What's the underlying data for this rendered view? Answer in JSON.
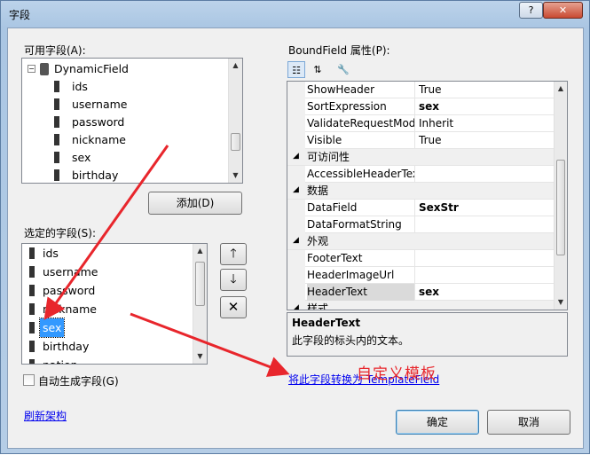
{
  "window": {
    "title": "字段",
    "help_glyph": "?",
    "close_glyph": "✕"
  },
  "available": {
    "label": "可用字段(A):",
    "root": "DynamicField",
    "items": [
      "ids",
      "username",
      "password",
      "nickname",
      "sex",
      "birthday"
    ]
  },
  "add_button": "添加(D)",
  "selected": {
    "label": "选定的字段(S):",
    "items": [
      "ids",
      "username",
      "password",
      "nickname",
      "sex",
      "birthday",
      "nation"
    ],
    "selected_item": "sex"
  },
  "auto_generate_label": "自动生成字段(G)",
  "refresh_link": "刷新架构",
  "properties": {
    "label": "BoundField 属性(P):",
    "rows": [
      {
        "kind": "prop",
        "name": "ShowHeader",
        "value": "True"
      },
      {
        "kind": "prop",
        "name": "SortExpression",
        "value": "sex",
        "bold": true
      },
      {
        "kind": "prop",
        "name": "ValidateRequestMode",
        "value": "Inherit"
      },
      {
        "kind": "prop",
        "name": "Visible",
        "value": "True"
      },
      {
        "kind": "cat",
        "name": "可访问性"
      },
      {
        "kind": "prop",
        "name": "AccessibleHeaderText",
        "value": ""
      },
      {
        "kind": "cat",
        "name": "数据"
      },
      {
        "kind": "prop",
        "name": "DataField",
        "value": "SexStr",
        "bold": true
      },
      {
        "kind": "prop",
        "name": "DataFormatString",
        "value": ""
      },
      {
        "kind": "cat",
        "name": "外观"
      },
      {
        "kind": "prop",
        "name": "FooterText",
        "value": ""
      },
      {
        "kind": "prop",
        "name": "HeaderImageUrl",
        "value": ""
      },
      {
        "kind": "prop",
        "name": "HeaderText",
        "value": "sex",
        "bold": true,
        "selected": true
      },
      {
        "kind": "cat",
        "name": "样式"
      }
    ],
    "desc_title": "HeaderText",
    "desc_text": "此字段的标头内的文本。"
  },
  "convert_link": "将此字段转换为 TemplateField",
  "annotation": "自定义模板",
  "ok_button": "确定",
  "cancel_button": "取消",
  "colors": {
    "arrow": "#e8262c",
    "selection": "#3399ff",
    "link": "#0000ee"
  }
}
